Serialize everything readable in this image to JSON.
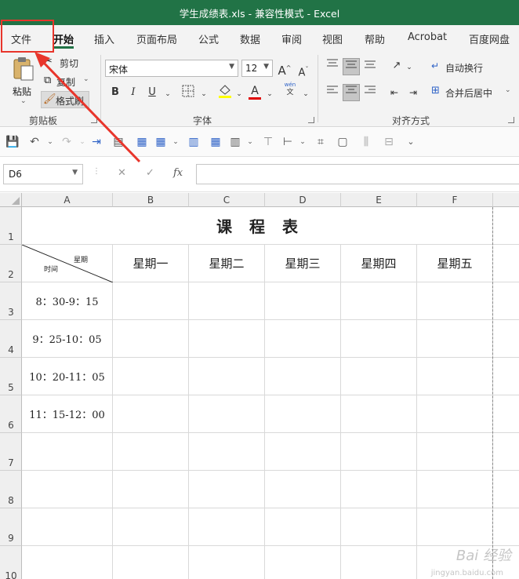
{
  "window": {
    "title": "学生成绩表.xls  -  兼容性模式  -  Excel",
    "title_bar_color": "#217346"
  },
  "ribbon_tabs": [
    {
      "label": "文件"
    },
    {
      "label": "开始"
    },
    {
      "label": "插入"
    },
    {
      "label": "页面布局"
    },
    {
      "label": "公式"
    },
    {
      "label": "数据"
    },
    {
      "label": "审阅"
    },
    {
      "label": "视图"
    },
    {
      "label": "帮助"
    },
    {
      "label": "Acrobat"
    },
    {
      "label": "百度网盘"
    }
  ],
  "active_tab": "开始",
  "highlight_color": "#e8352b",
  "clipboard": {
    "paste_label": "粘贴",
    "cut_label": "剪切",
    "copy_label": "复制",
    "format_painter_label": "格式刷",
    "group_label": "剪贴板"
  },
  "font": {
    "font_name": "宋体",
    "font_size": "12",
    "grow_label": "A",
    "shrink_label": "A",
    "bold": "B",
    "italic": "I",
    "underline": "U",
    "wen_top": "wén",
    "wen_bottom": "文",
    "font_color_letter": "A",
    "group_label": "字体",
    "highlight_color": "#ffff00",
    "font_color": "#e00000"
  },
  "alignment": {
    "wrap_text_label": "自动换行",
    "merge_center_label": "合并后居中",
    "group_label": "对齐方式"
  },
  "formula_bar": {
    "name_box": "D6",
    "fx": "fx",
    "cancel": "✕",
    "enter": "✓",
    "formula": ""
  },
  "columns": [
    "A",
    "B",
    "C",
    "D",
    "E",
    "F"
  ],
  "rows": [
    "1",
    "2",
    "3",
    "4",
    "5",
    "6",
    "7",
    "8",
    "9",
    "10"
  ],
  "sheet": {
    "title": "课程表",
    "header_diag_top": "星期",
    "header_diag_bottom": "时间",
    "weekdays": [
      "星期一",
      "星期二",
      "星期三",
      "星期四",
      "星期五"
    ],
    "times": [
      "8：30-9：15",
      "9：25-10：05",
      "10：20-11：05",
      "11：15-12：00"
    ]
  },
  "watermark": {
    "brand": "Bai 经验",
    "url": "jingyan.baidu.com"
  }
}
